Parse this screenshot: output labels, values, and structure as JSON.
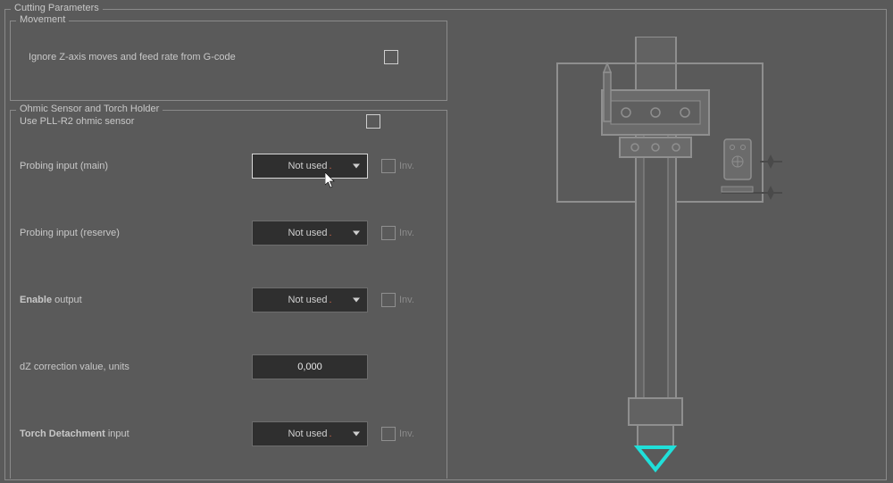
{
  "cutting_parameters": {
    "title": "Cutting Parameters",
    "movement": {
      "title": "Movement",
      "ignore_z_label": "Ignore Z-axis moves and feed rate from G-code"
    },
    "ohmic": {
      "title": "Ohmic Sensor and Torch Holder",
      "use_pll_label": "Use PLL-R2 ohmic sensor",
      "probing_main": {
        "label": "Probing input (main)",
        "value": "Not used",
        "inv_label": "Inv."
      },
      "probing_reserve": {
        "label": "Probing input (reserve)",
        "value": "Not used",
        "inv_label": "Inv."
      },
      "enable_output": {
        "label_bold": "Enable",
        "label_rest": " output",
        "value": "Not used",
        "inv_label": "Inv."
      },
      "dz_correction": {
        "label": "dZ correction value, units",
        "value": "0,000"
      },
      "torch_detachment": {
        "label_bold": "Torch Detachment",
        "label_rest": " input",
        "value": "Not used",
        "inv_label": "Inv."
      }
    }
  }
}
